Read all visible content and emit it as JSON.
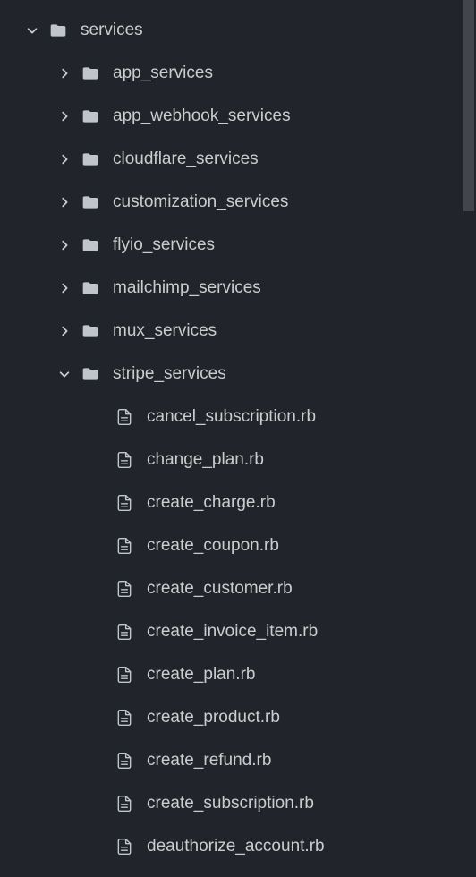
{
  "tree": [
    {
      "label": "services",
      "type": "folder",
      "expanded": true,
      "depth": 0
    },
    {
      "label": "app_services",
      "type": "folder",
      "expanded": false,
      "depth": 1
    },
    {
      "label": "app_webhook_services",
      "type": "folder",
      "expanded": false,
      "depth": 1
    },
    {
      "label": "cloudflare_services",
      "type": "folder",
      "expanded": false,
      "depth": 1
    },
    {
      "label": "customization_services",
      "type": "folder",
      "expanded": false,
      "depth": 1
    },
    {
      "label": "flyio_services",
      "type": "folder",
      "expanded": false,
      "depth": 1
    },
    {
      "label": "mailchimp_services",
      "type": "folder",
      "expanded": false,
      "depth": 1
    },
    {
      "label": "mux_services",
      "type": "folder",
      "expanded": false,
      "depth": 1
    },
    {
      "label": "stripe_services",
      "type": "folder",
      "expanded": true,
      "depth": 1
    },
    {
      "label": "cancel_subscription.rb",
      "type": "file",
      "depth": 2
    },
    {
      "label": "change_plan.rb",
      "type": "file",
      "depth": 2
    },
    {
      "label": "create_charge.rb",
      "type": "file",
      "depth": 2
    },
    {
      "label": "create_coupon.rb",
      "type": "file",
      "depth": 2
    },
    {
      "label": "create_customer.rb",
      "type": "file",
      "depth": 2
    },
    {
      "label": "create_invoice_item.rb",
      "type": "file",
      "depth": 2
    },
    {
      "label": "create_plan.rb",
      "type": "file",
      "depth": 2
    },
    {
      "label": "create_product.rb",
      "type": "file",
      "depth": 2
    },
    {
      "label": "create_refund.rb",
      "type": "file",
      "depth": 2
    },
    {
      "label": "create_subscription.rb",
      "type": "file",
      "depth": 2
    },
    {
      "label": "deauthorize_account.rb",
      "type": "file",
      "depth": 2
    }
  ],
  "colors": {
    "background": "#21252b",
    "text": "#cccccc",
    "iconFill": "#c0c4cc"
  }
}
